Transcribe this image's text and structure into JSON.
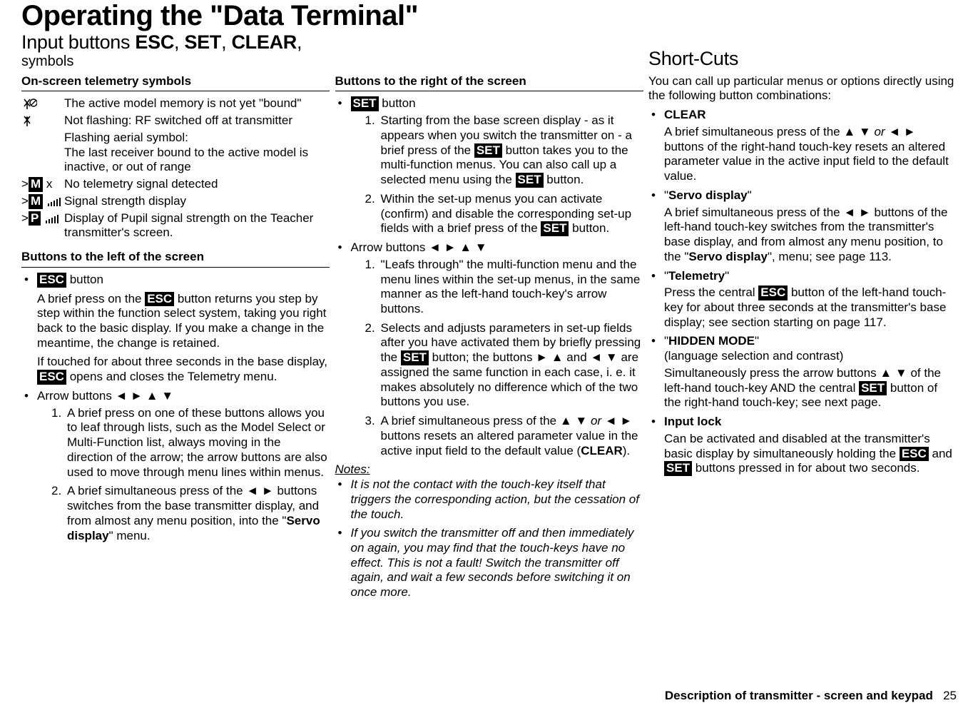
{
  "header": {
    "title": "Operating the \"Data Terminal\"",
    "subtitle_prefix": "Input buttons ",
    "subtitle_b1": "ESC",
    "subtitle_sep1": ", ",
    "subtitle_b2": "SET",
    "subtitle_sep2": ", ",
    "subtitle_b3": "CLEAR",
    "subtitle_suffix": ",",
    "symbols_label": "symbols",
    "right_heading": "Short-Cuts"
  },
  "col1": {
    "section1": "On-screen telemetry symbols",
    "symbols": [
      {
        "desc": "The active model memory is not yet \"bound\""
      },
      {
        "desc": "Not flashing: RF switched off at transmitter"
      },
      {
        "desc_a": "Flashing aerial symbol:",
        "desc_b": "The last receiver bound to the active model is inactive, or out of range"
      },
      {
        "prefix": ">",
        "letter": "M",
        "suffix": " x",
        "desc": "No telemetry signal detected"
      },
      {
        "prefix": ">",
        "letter": "M",
        "desc": "Signal strength display"
      },
      {
        "prefix": ">",
        "letter": "P",
        "desc": "Display of Pupil signal strength on the Teacher transmitter's screen."
      }
    ],
    "section2": "Buttons to the left of the screen",
    "esc": {
      "label": "ESC",
      "after": " button",
      "p1a": "A brief press on the ",
      "p1b": " button returns you step by step within the function select system, taking you right back to the basic display. If you make a change in the meantime, the change is retained.",
      "p2a": "If touched for about three seconds in the base display, ",
      "p2b": " opens and closes the Telemetry menu."
    },
    "arrow_label": "Arrow buttons ◄ ► ▲ ▼",
    "arrow_items": {
      "i1": "A brief press on one of these buttons allows you to leaf through lists, such as the Model Select or Multi-Function list, always moving in the direction of the arrow; the arrow buttons are also used to move through menu lines within menus.",
      "i2a": "A brief simultaneous press of the ◄ ► buttons switches from the base transmitter display, and from almost any menu position, into the \"",
      "i2b": "Servo display",
      "i2c": "\" menu."
    }
  },
  "col2": {
    "section": "Buttons to the right of the screen",
    "set": {
      "label": "SET",
      "after": " button",
      "i1a": "Starting from the base screen display - as it appears when you switch the transmitter on - a brief press of the ",
      "i1b": " button takes you to the multi-function menus. You can also call up a selected menu using the ",
      "i1c": " button.",
      "i2a": "Within the set-up menus you can activate (confirm) and disable the corresponding set-up fields with a brief press of the ",
      "i2b": " button."
    },
    "arrow_label": "Arrow buttons ◄ ► ▲ ▼",
    "arrow_items": {
      "i1": "\"Leafs through\" the multi-function menu and the menu lines within the set-up menus, in the same manner as the left-hand touch-key's arrow buttons.",
      "i2a": "Selects and adjusts parameters in set-up fields after you have activated them by briefly pressing the ",
      "i2b": " button; the buttons ► ▲ and ◄ ▼ are assigned the same function in each case, i. e. it makes absolutely no difference which of the two buttons you use.",
      "i3a": "A brief simultaneous press of the ▲ ▼ ",
      "i3or": "or",
      "i3b": " ◄ ► buttons resets an altered parameter value in the active input field to the default value (",
      "i3c": "CLEAR",
      "i3d": ")."
    },
    "notes_title": "Notes:",
    "notes": {
      "n1": "It is not the contact with the touch-key itself that triggers the corresponding action, but the cessation of the touch.",
      "n2": "If you switch the transmitter off and then immediately on again, you may find that the touch-keys have no effect. This is not a fault! Switch the transmitter off again, and wait a few seconds before switching it on once more."
    }
  },
  "col3": {
    "intro": "You can call up particular menus or options directly using the following button combinations:",
    "clear": {
      "title": "CLEAR",
      "p": "A brief simultaneous press of the ▲ ▼ ",
      "or": "or",
      "p2": " ◄ ► buttons of the right-hand touch-key resets an altered parameter value in the active input field to the default value."
    },
    "servo": {
      "title_q1": "\"",
      "title": "Servo display",
      "title_q2": "\"",
      "p1": "A brief simultaneous press of the ◄ ► buttons of the left-hand touch-key switches from the transmitter's base display, and from almost any menu position, to the \"",
      "p1b": "Servo display",
      "p1c": "\", menu; see page 113."
    },
    "telemetry": {
      "title_q1": "\"",
      "title": "Telemetry",
      "title_q2": "\"",
      "p1": "Press the central ",
      "p2": " button of the left-hand touch-key for about three seconds at the transmitter's base display; see section starting on page 117."
    },
    "hidden": {
      "title_q1": "\"",
      "title": "HIDDEN MODE",
      "title_q2": "\"",
      "sub": "(language selection and contrast)",
      "p1": "Simultaneously press the arrow buttons ▲ ▼ of the left-hand touch-key AND the central ",
      "p2": " button of the right-hand touch-key; see next page."
    },
    "inputlock": {
      "title": "Input lock",
      "p1": "Can be activated and disabled at the transmitter's basic display by simultaneously holding the ",
      "p2": " and ",
      "p3": " buttons pressed in for about two seconds."
    }
  },
  "footer": {
    "label": "Description of transmitter - screen and keypad",
    "page": "25"
  },
  "labels": {
    "set": "SET",
    "esc": "ESC"
  }
}
